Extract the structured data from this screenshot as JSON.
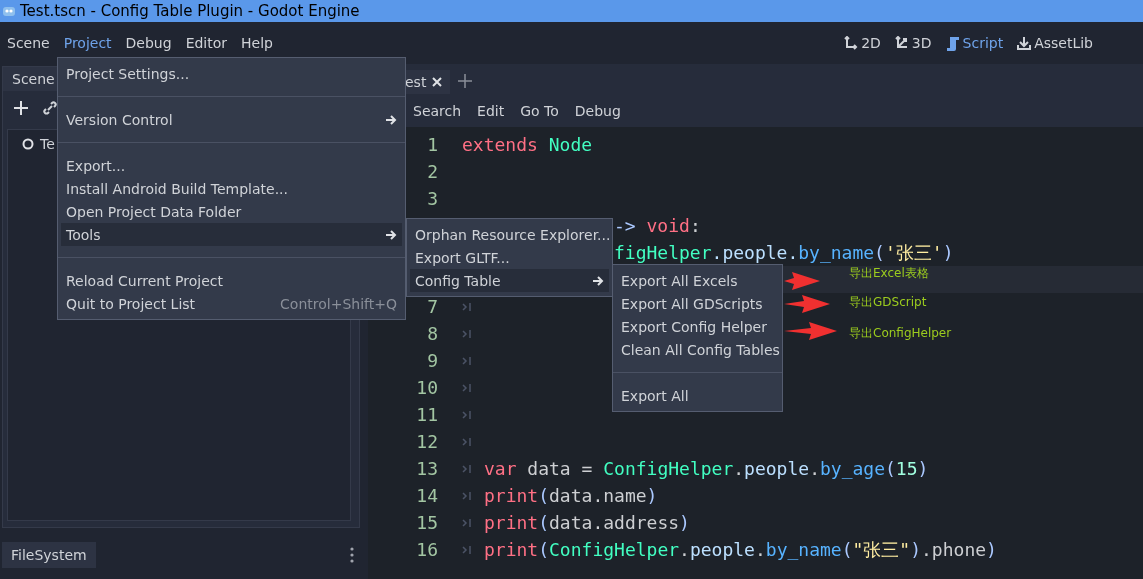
{
  "window": {
    "title": "Test.tscn - Config Table Plugin - Godot Engine"
  },
  "menubar": [
    {
      "label": "Scene",
      "selected": false
    },
    {
      "label": "Project",
      "selected": true
    },
    {
      "label": "Debug",
      "selected": false
    },
    {
      "label": "Editor",
      "selected": false
    },
    {
      "label": "Help",
      "selected": false
    }
  ],
  "workspaces": [
    {
      "label": "2D",
      "kind": "flat",
      "selected": false
    },
    {
      "label": "3D",
      "kind": "spatial",
      "selected": false
    },
    {
      "label": "Script",
      "kind": "script",
      "selected": true
    },
    {
      "label": "AssetLib",
      "kind": "assetlib",
      "selected": false
    }
  ],
  "scene_dock": {
    "tab": "Scene",
    "tree": [
      {
        "label": "Te"
      }
    ]
  },
  "filesystem_dock": {
    "tab": "FileSystem"
  },
  "editor": {
    "tab": "est",
    "script_menu": [
      "Search",
      "Edit",
      "Go To",
      "Debug"
    ],
    "lines": [
      {
        "number": "1",
        "tab": false,
        "current": false,
        "tokens": [
          {
            "kind": "keyword",
            "text": "extends "
          },
          {
            "kind": "class",
            "text": "Node"
          }
        ]
      },
      {
        "number": "2",
        "tab": false,
        "current": false
      },
      {
        "number": "3",
        "tab": false,
        "current": false
      },
      {
        "tab": false,
        "current": false,
        "tokens": [
          {
            "kind": "symbol",
            "text": "-> "
          },
          {
            "kind": "keyword",
            "text": "void"
          },
          {
            "kind": "plain",
            "text": ":"
          }
        ]
      },
      {
        "tab": false,
        "current": false,
        "tokens": [
          {
            "kind": "class",
            "text": "figHelper"
          },
          {
            "kind": "member",
            "text": ".people."
          },
          {
            "kind": "function",
            "text": "by_name"
          },
          {
            "kind": "symbol",
            "text": "("
          },
          {
            "kind": "string",
            "text": "'张三'"
          },
          {
            "kind": "symbol",
            "text": ")"
          }
        ]
      },
      {
        "tab": false,
        "current": true
      },
      {
        "number": "7",
        "tab": true,
        "current": false
      },
      {
        "number": "8",
        "tab": true,
        "current": false
      },
      {
        "number": "9",
        "tab": true,
        "current": false
      },
      {
        "number": "10",
        "tab": true,
        "current": false
      },
      {
        "number": "11",
        "tab": true,
        "current": false
      },
      {
        "number": "12",
        "tab": true,
        "current": false
      },
      {
        "number": "13",
        "tab": true,
        "current": false,
        "tokens": [
          {
            "kind": "keyword",
            "text": "var"
          },
          {
            "kind": "plain",
            "text": " data = "
          },
          {
            "kind": "class",
            "text": "ConfigHelper"
          },
          {
            "kind": "plain",
            "text": "."
          },
          {
            "kind": "member",
            "text": "people"
          },
          {
            "kind": "plain",
            "text": "."
          },
          {
            "kind": "function",
            "text": "by_age"
          },
          {
            "kind": "symbol",
            "text": "("
          },
          {
            "kind": "number",
            "text": "15"
          },
          {
            "kind": "symbol",
            "text": ")"
          }
        ]
      },
      {
        "number": "14",
        "tab": true,
        "current": false,
        "tokens": [
          {
            "kind": "keyword",
            "text": "print"
          },
          {
            "kind": "symbol",
            "text": "("
          },
          {
            "kind": "plain",
            "text": "data.name"
          },
          {
            "kind": "symbol",
            "text": ")"
          }
        ]
      },
      {
        "number": "15",
        "tab": true,
        "current": false,
        "tokens": [
          {
            "kind": "keyword",
            "text": "print"
          },
          {
            "kind": "symbol",
            "text": "("
          },
          {
            "kind": "plain",
            "text": "data.address"
          },
          {
            "kind": "symbol",
            "text": ")"
          }
        ]
      },
      {
        "number": "16",
        "tab": true,
        "current": false,
        "tokens": [
          {
            "kind": "keyword",
            "text": "print"
          },
          {
            "kind": "symbol",
            "text": "("
          },
          {
            "kind": "class",
            "text": "ConfigHelper"
          },
          {
            "kind": "plain",
            "text": "."
          },
          {
            "kind": "member",
            "text": "people"
          },
          {
            "kind": "plain",
            "text": "."
          },
          {
            "kind": "function",
            "text": "by_name"
          },
          {
            "kind": "symbol",
            "text": "("
          },
          {
            "kind": "string",
            "text": "\"张三\""
          },
          {
            "kind": "symbol",
            "text": ")"
          },
          {
            "kind": "plain",
            "text": ".phone"
          },
          {
            "kind": "symbol",
            "text": ")"
          }
        ]
      }
    ]
  },
  "project_menu": [
    {
      "kind": "item",
      "label": "Project Settings...",
      "selected": false
    },
    {
      "kind": "separator"
    },
    {
      "kind": "submenu",
      "label": "Version Control",
      "selected": false
    },
    {
      "kind": "separator"
    },
    {
      "kind": "item",
      "label": "Export...",
      "selected": false
    },
    {
      "kind": "item",
      "label": "Install Android Build Template...",
      "selected": false
    },
    {
      "kind": "item",
      "label": "Open Project Data Folder",
      "selected": false
    },
    {
      "kind": "submenu",
      "label": "Tools",
      "selected": true
    },
    {
      "kind": "separator"
    },
    {
      "kind": "item",
      "label": "Reload Current Project",
      "selected": false
    },
    {
      "kind": "item",
      "label": "Quit to Project List",
      "shortcut": "Control+Shift+Q",
      "selected": false
    }
  ],
  "tools_menu": [
    {
      "kind": "item",
      "label": "Orphan Resource Explorer...",
      "selected": false
    },
    {
      "kind": "item",
      "label": "Export GLTF...",
      "selected": false
    },
    {
      "kind": "submenu",
      "label": "Config Table",
      "selected": true
    }
  ],
  "config_table_menu": [
    {
      "kind": "item",
      "label": "Export All Excels",
      "selected": false
    },
    {
      "kind": "item",
      "label": "Export All GDScripts",
      "selected": false
    },
    {
      "kind": "item",
      "label": "Export Config Helper",
      "selected": false
    },
    {
      "kind": "item",
      "label": "Clean All Config Tables",
      "selected": false
    },
    {
      "kind": "separator"
    },
    {
      "kind": "item",
      "label": "Export All",
      "selected": false
    }
  ],
  "annotations": [
    {
      "text": "导出Excel表格"
    },
    {
      "text": "导出GDScript"
    },
    {
      "text": "导出ConfigHelper"
    }
  ]
}
